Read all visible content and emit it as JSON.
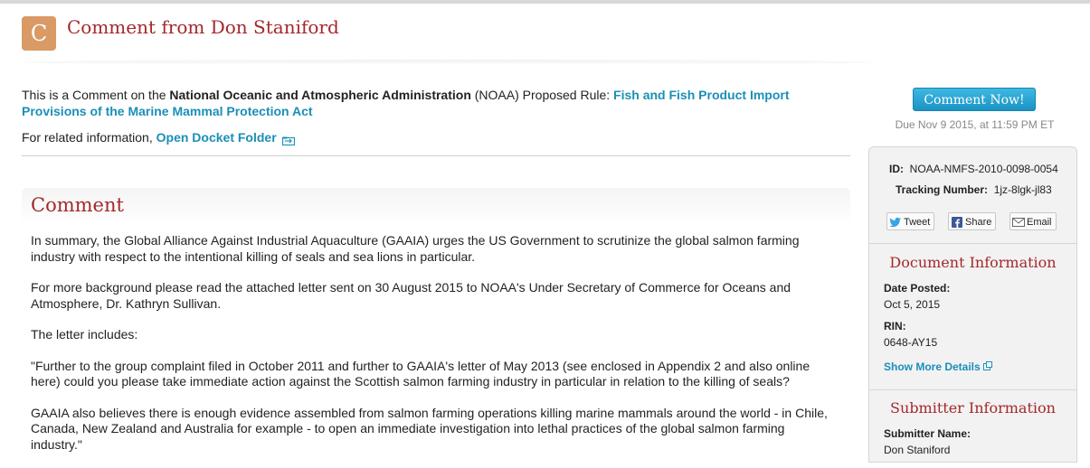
{
  "header": {
    "badge_letter": "C",
    "title": "Comment from Don Staniford"
  },
  "intro": {
    "prefix": "This is a Comment on the ",
    "agency": "National Oceanic and Atmospheric Administration",
    "agency_abbrev": " (NOAA) Proposed Rule: ",
    "rule_link": "Fish and Fish Product Import Provisions of the Marine Mammal Protection Act",
    "related_prefix": "For related information, ",
    "docket_link": "Open Docket Folder"
  },
  "comment": {
    "heading": "Comment",
    "paragraphs": [
      "In summary, the Global Alliance Against Industrial Aquaculture (GAAIA) urges the US Government to scrutinize the global salmon farming industry with respect to the intentional killing of seals and sea lions in particular.",
      "For more background please read the attached letter sent on 30 August 2015 to NOAA's Under Secretary of Commerce for Oceans and Atmosphere, Dr. Kathryn Sullivan.",
      "The letter includes:",
      "\"Further to the group complaint filed in October 2011 and further to GAAIA's letter of May 2013 (see enclosed in Appendix 2 and also online here) could you please take immediate action against the Scottish salmon farming industry in particular in relation to the killing of seals?",
      "GAAIA also believes there is enough evidence assembled from salmon farming operations killing marine mammals around the world - in Chile, Canada, New Zealand and Australia for example - to open an immediate investigation into lethal practices of the global salmon farming industry.\""
    ]
  },
  "sidebar": {
    "comment_now": "Comment Now!",
    "due": "Due Nov 9 2015, at 11:59 PM ET",
    "id_label": "ID:",
    "id_value": "NOAA-NMFS-2010-0098-0054",
    "tracking_label": "Tracking Number:",
    "tracking_value": "1jz-8lgk-jl83",
    "share": {
      "tweet": "Tweet",
      "facebook": "Share",
      "email": "Email"
    },
    "doc_info": {
      "title": "Document Information",
      "date_posted_label": "Date Posted:",
      "date_posted_value": "Oct 5, 2015",
      "rin_label": "RIN:",
      "rin_value": "0648-AY15",
      "show_more": "Show More Details"
    },
    "submitter_info": {
      "title": "Submitter Information",
      "name_label": "Submitter Name:",
      "name_value": "Don Staniford"
    }
  },
  "colors": {
    "title_red": "#a4282b",
    "link_blue": "#1a8fb8",
    "badge_orange": "#d99a66",
    "button_blue": "#2aa6d6"
  }
}
